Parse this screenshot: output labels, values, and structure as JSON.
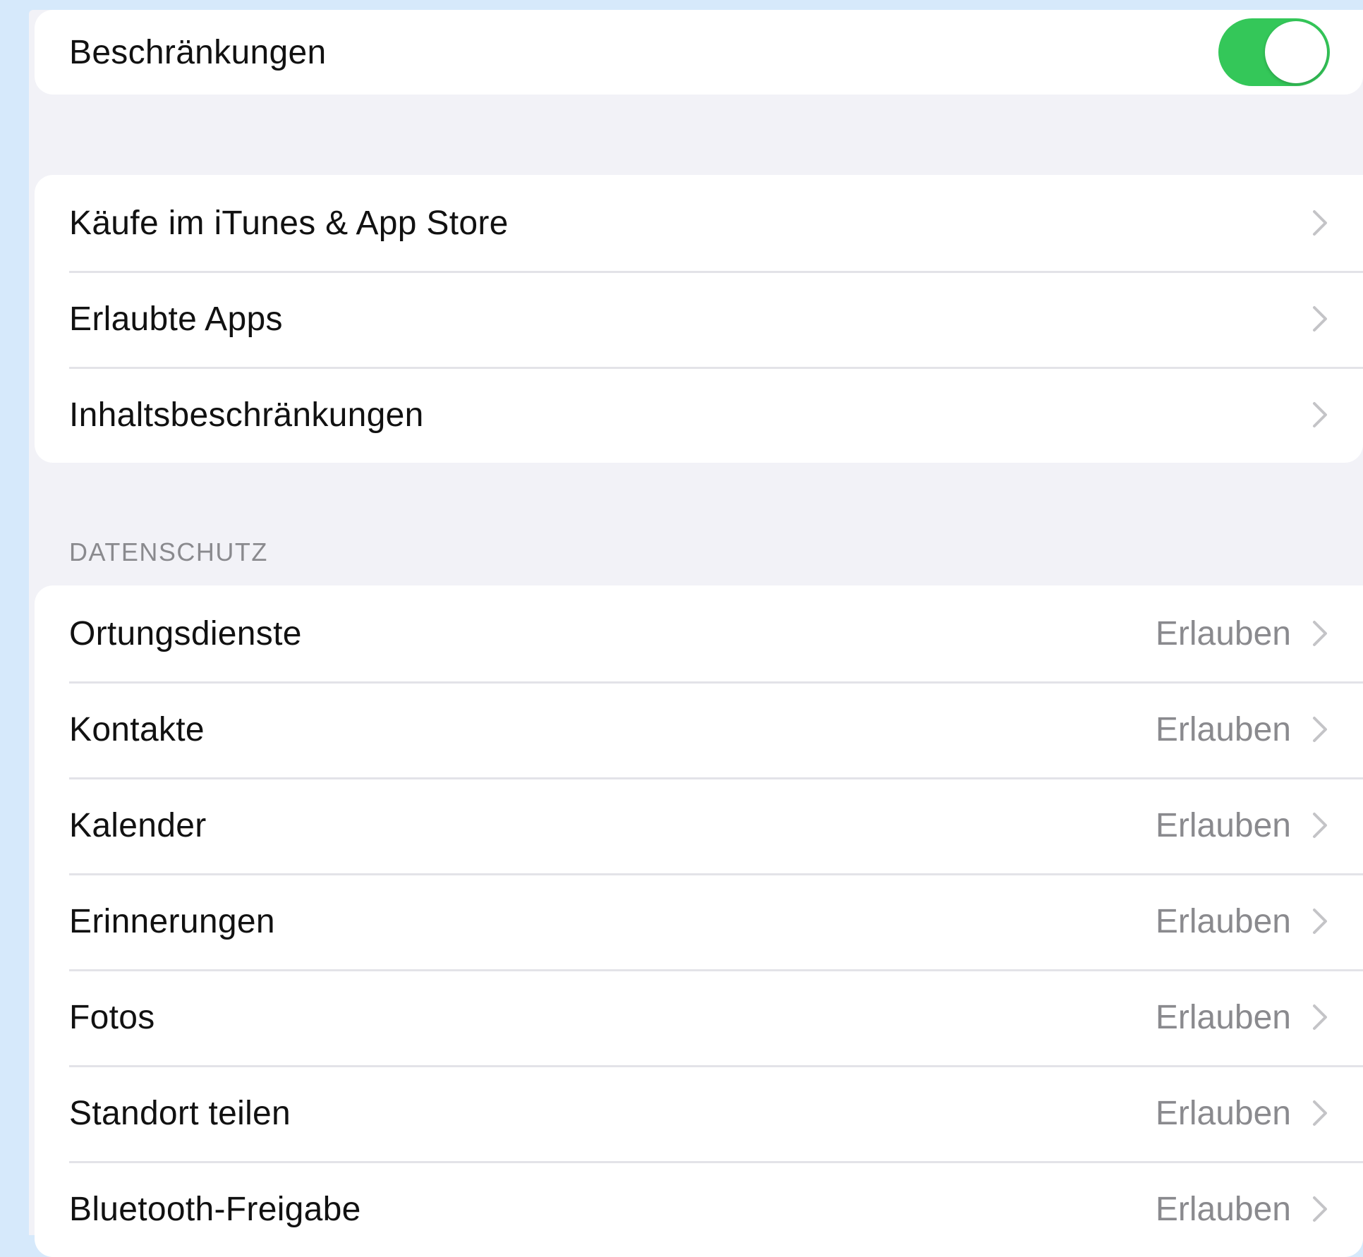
{
  "restrictions": {
    "label": "Beschränkungen",
    "enabled": true,
    "toggle_color": "#34c759"
  },
  "general_group": {
    "items": [
      {
        "label": "Käufe im iTunes & App Store"
      },
      {
        "label": "Erlaubte Apps"
      },
      {
        "label": "Inhaltsbeschränkungen"
      }
    ]
  },
  "privacy": {
    "header": "DATENSCHUTZ",
    "items": [
      {
        "label": "Ortungsdienste",
        "value": "Erlauben"
      },
      {
        "label": "Kontakte",
        "value": "Erlauben"
      },
      {
        "label": "Kalender",
        "value": "Erlauben"
      },
      {
        "label": "Erinnerungen",
        "value": "Erlauben"
      },
      {
        "label": "Fotos",
        "value": "Erlauben"
      },
      {
        "label": "Standort teilen",
        "value": "Erlauben"
      },
      {
        "label": "Bluetooth-Freigabe",
        "value": "Erlauben"
      }
    ]
  },
  "icons": {
    "chevron": "chevron-right-icon"
  }
}
